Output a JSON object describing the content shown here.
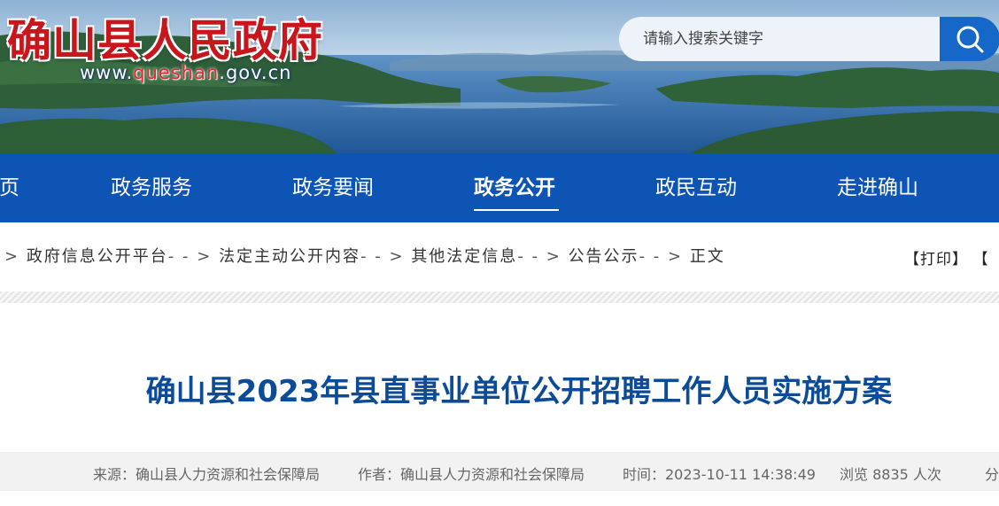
{
  "header": {
    "site_title": "确山县人民政府",
    "url_prefix": "www.",
    "url_highlight": "queshan",
    "url_suffix": ".gov.cn",
    "search_placeholder": "请输入搜索关键字",
    "search_icon": "search-icon"
  },
  "nav": {
    "items": [
      {
        "label": "页"
      },
      {
        "label": "政务服务"
      },
      {
        "label": "政务要闻"
      },
      {
        "label": "政务公开",
        "active": true
      },
      {
        "label": "政民互动"
      },
      {
        "label": "走进确山"
      }
    ]
  },
  "breadcrumb": {
    "separator": "> ",
    "dash_sep": "- - > ",
    "items": [
      "政府信息公开平台",
      "法定主动公开内容",
      "其他法定信息",
      "公告公示",
      "正文"
    ],
    "tools": [
      "【打印】",
      "【"
    ]
  },
  "article": {
    "title": "确山县2023年县直事业单位公开招聘工作人员实施方案",
    "source": "来源：确山县人力资源和社会保障局",
    "author": "作者：确山县人力资源和社会保障局",
    "time": "时间：2023-10-11 14:38:49",
    "views": "浏览 8835 人次",
    "share": "分"
  },
  "colors": {
    "nav_bg": "#0e54b5",
    "title_red": "#c8161d",
    "article_title": "#0c4b97",
    "search_button": "#1668c8"
  }
}
